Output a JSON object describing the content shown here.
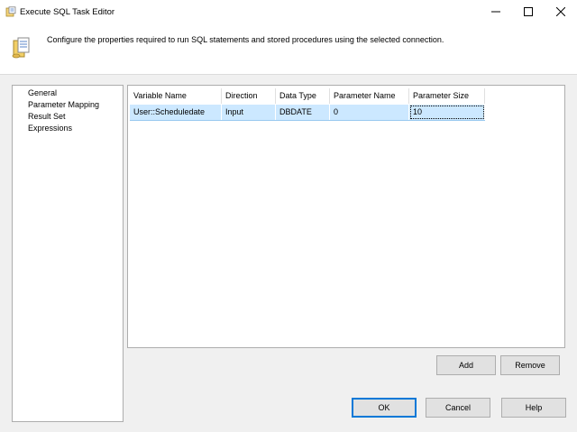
{
  "window": {
    "title": "Execute SQL Task Editor"
  },
  "header": {
    "description": "Configure the properties required to run SQL statements and stored procedures using the selected connection."
  },
  "nav": {
    "items": [
      "General",
      "Parameter Mapping",
      "Result Set",
      "Expressions"
    ],
    "selected": "Parameter Mapping"
  },
  "grid": {
    "columns": [
      "Variable Name",
      "Direction",
      "Data Type",
      "Parameter Name",
      "Parameter Size"
    ],
    "rows": [
      [
        "User::Scheduledate",
        "Input",
        "DBDATE",
        "0",
        "10"
      ]
    ]
  },
  "buttons": {
    "add": "Add",
    "remove": "Remove",
    "ok": "OK",
    "cancel": "Cancel",
    "help": "Help"
  },
  "icons": {
    "app": "sql-task-icon",
    "header": "database-scroll-icon"
  },
  "colors": {
    "selection": "#cce8ff",
    "default_border": "#0078d7"
  }
}
